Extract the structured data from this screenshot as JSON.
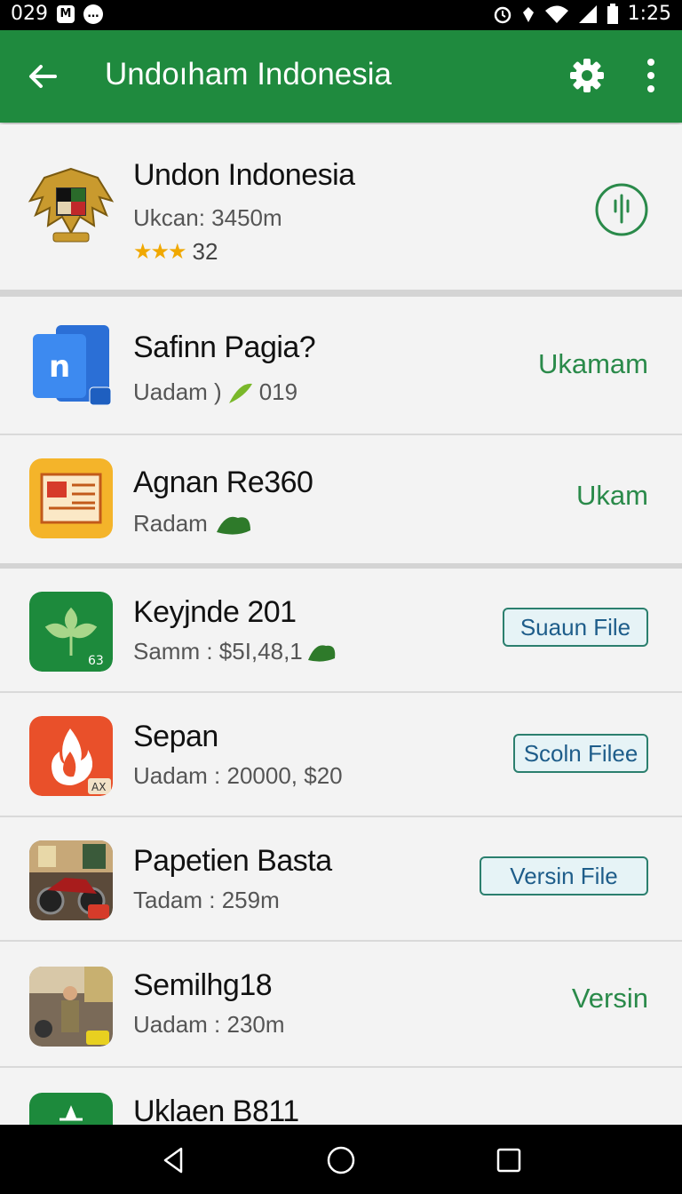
{
  "status_bar": {
    "left_text": "029",
    "time": "1:25"
  },
  "app_bar": {
    "title": "Undoıham Indonesia",
    "back_icon": "arrow-left-icon",
    "settings_icon": "gear-icon",
    "more_icon": "more-vertical-icon"
  },
  "header_app": {
    "name": "Undon Indonesia",
    "subtitle": "Ukcan: 3450m",
    "rating_count": "32",
    "stars": 3,
    "action_icon": "download-circle-icon"
  },
  "list": [
    {
      "name": "Safinn Pagia?",
      "sub": "Uadam )",
      "sub_tail": "019",
      "action": "Ukamam",
      "action_type": "text",
      "icon": "document-app-icon"
    },
    {
      "name": "Agnan Re360",
      "sub": "Radam",
      "sub_tail": "",
      "action": "Ukam",
      "action_type": "text",
      "icon": "newspaper-app-icon"
    },
    {
      "name": "Keyjnde 201",
      "sub": "Samm : $5I,48,1",
      "sub_tail": "",
      "action": "Suaun File",
      "action_type": "button",
      "icon": "leaf-app-icon",
      "badge": "63"
    },
    {
      "name": "Sepan",
      "sub": "Uadam : 20000, $20",
      "sub_tail": "",
      "action": "Scoln Filee",
      "action_type": "button",
      "icon": "flame-app-icon",
      "badge": "AX"
    },
    {
      "name": "Papetien Basta",
      "sub": "Tadam : 259m",
      "sub_tail": "",
      "action": "Versin File",
      "action_type": "button",
      "icon": "motorbike-photo-icon"
    },
    {
      "name": "Semilhg18",
      "sub": "Uadam : 230m",
      "sub_tail": "",
      "action": "Versin",
      "action_type": "text",
      "icon": "street-photo-icon"
    },
    {
      "name": "Uklaen B811",
      "sub": "",
      "sub_tail": "",
      "action": "",
      "action_type": "text",
      "icon": "star-app-icon"
    }
  ],
  "nav_bar": {
    "back_icon": "nav-back-triangle-icon",
    "home_icon": "nav-home-circle-icon",
    "recents_icon": "nav-recents-square-icon"
  },
  "colors": {
    "app_bar": "#1f8a3e",
    "action_green": "#2a8a4a",
    "button_border": "#2b7f6e"
  }
}
